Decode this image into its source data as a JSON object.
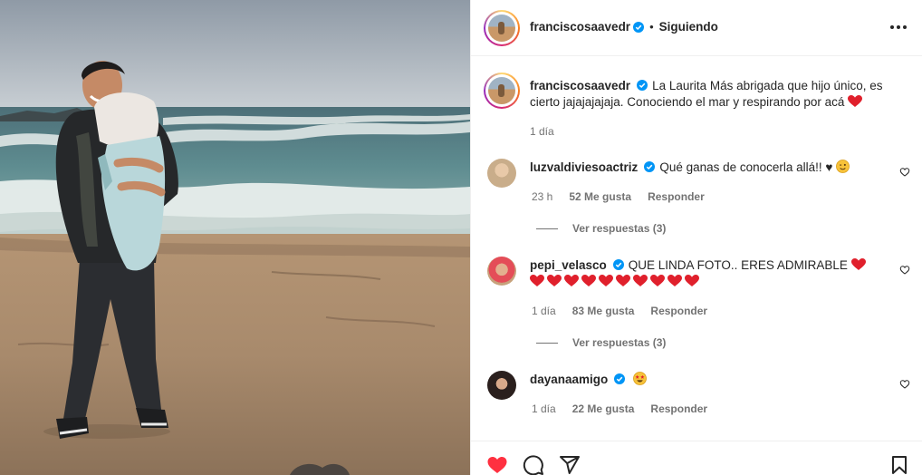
{
  "post": {
    "author": "franciscosaavedr",
    "follow_status": "Siguiendo",
    "dot": "•",
    "caption": "La Laurita Más abrigada que hijo único, es cierto jajajajajaja. Conociendo el mar y respirando por acá",
    "caption_time": "1 día"
  },
  "comments": [
    {
      "username": "luzvaldiviesoactriz",
      "text": "Qué ganas de conocerla allá!! ♥",
      "time": "23 h",
      "likes": "52 Me gusta",
      "reply": "Responder",
      "view_replies": "Ver respuestas (3)"
    },
    {
      "username": "pepi_velasco",
      "text": "QUE LINDA FOTO.. ERES ADMIRABLE",
      "time": "1 día",
      "likes": "83 Me gusta",
      "reply": "Responder",
      "view_replies": "Ver respuestas (3)"
    },
    {
      "username": "dayanaamigo",
      "text": "",
      "time": "1 día",
      "likes": "22 Me gusta",
      "reply": "Responder"
    }
  ],
  "icons": {
    "like": "heart-filled-icon",
    "comment": "comment-icon",
    "share": "paper-plane-icon",
    "save": "bookmark-icon",
    "more": "more-options-icon",
    "verified": "verified-badge-icon"
  },
  "colors": {
    "like_red": "#ff3040",
    "verified_blue": "#0095f6",
    "muted_text": "#737373",
    "heart_emoji": "#e0202c"
  }
}
